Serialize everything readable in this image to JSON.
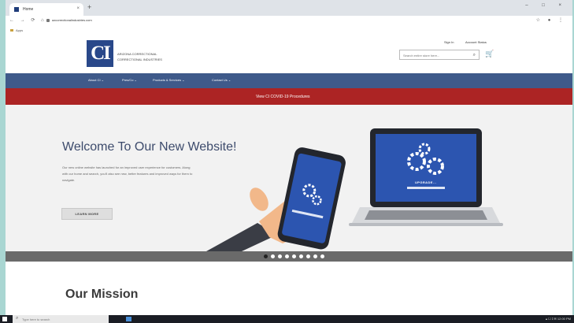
{
  "browser": {
    "tab_title": "Home",
    "tab_close": "×",
    "new_tab": "+",
    "window_controls": "– □ ×",
    "nav_buttons": "← → ⟳ ⌂",
    "url": "azcorrectionalindustries.com",
    "toolbar_icons": "☆ ● ⋮",
    "bookmark": "Apps"
  },
  "header": {
    "logo_mark": "CI",
    "logo_line1": "ARIZONA CORRECTIONAL",
    "logo_line2": "CORRECTIONAL INDUSTRIES",
    "sign_in": "Sign In",
    "account": "Account Status",
    "search_placeholder": "Search entire store here...",
    "search_icon": "⌕",
    "cart_icon": "🛒"
  },
  "nav": {
    "items": [
      "About CI ⌄",
      "Pres/Co ⌄",
      "Products & Services ⌄",
      "Contact Us ⌄"
    ]
  },
  "alert": {
    "text": "View CI COVID-19 Procedures"
  },
  "hero": {
    "title": "Welcome To Our New Website!",
    "text": "Our new online website has launched for an improved user experience for customers. Along with our home and search, you'll also see new, better features and improved ways for them to navigate.",
    "button": "LEARN MORE",
    "laptop_label": "UPGRADE..."
  },
  "slider": {
    "count": 9,
    "active": 0
  },
  "mission": {
    "title": "Our Mission"
  },
  "taskbar": {
    "search_placeholder": "Type here to search",
    "search_icon": "⌕",
    "tray": "▴ ☐ ⟟ ✉ 12:00 PM"
  },
  "colors": {
    "brand": "#29488a",
    "nav": "#3f5a8a",
    "alert": "#ac2424"
  }
}
